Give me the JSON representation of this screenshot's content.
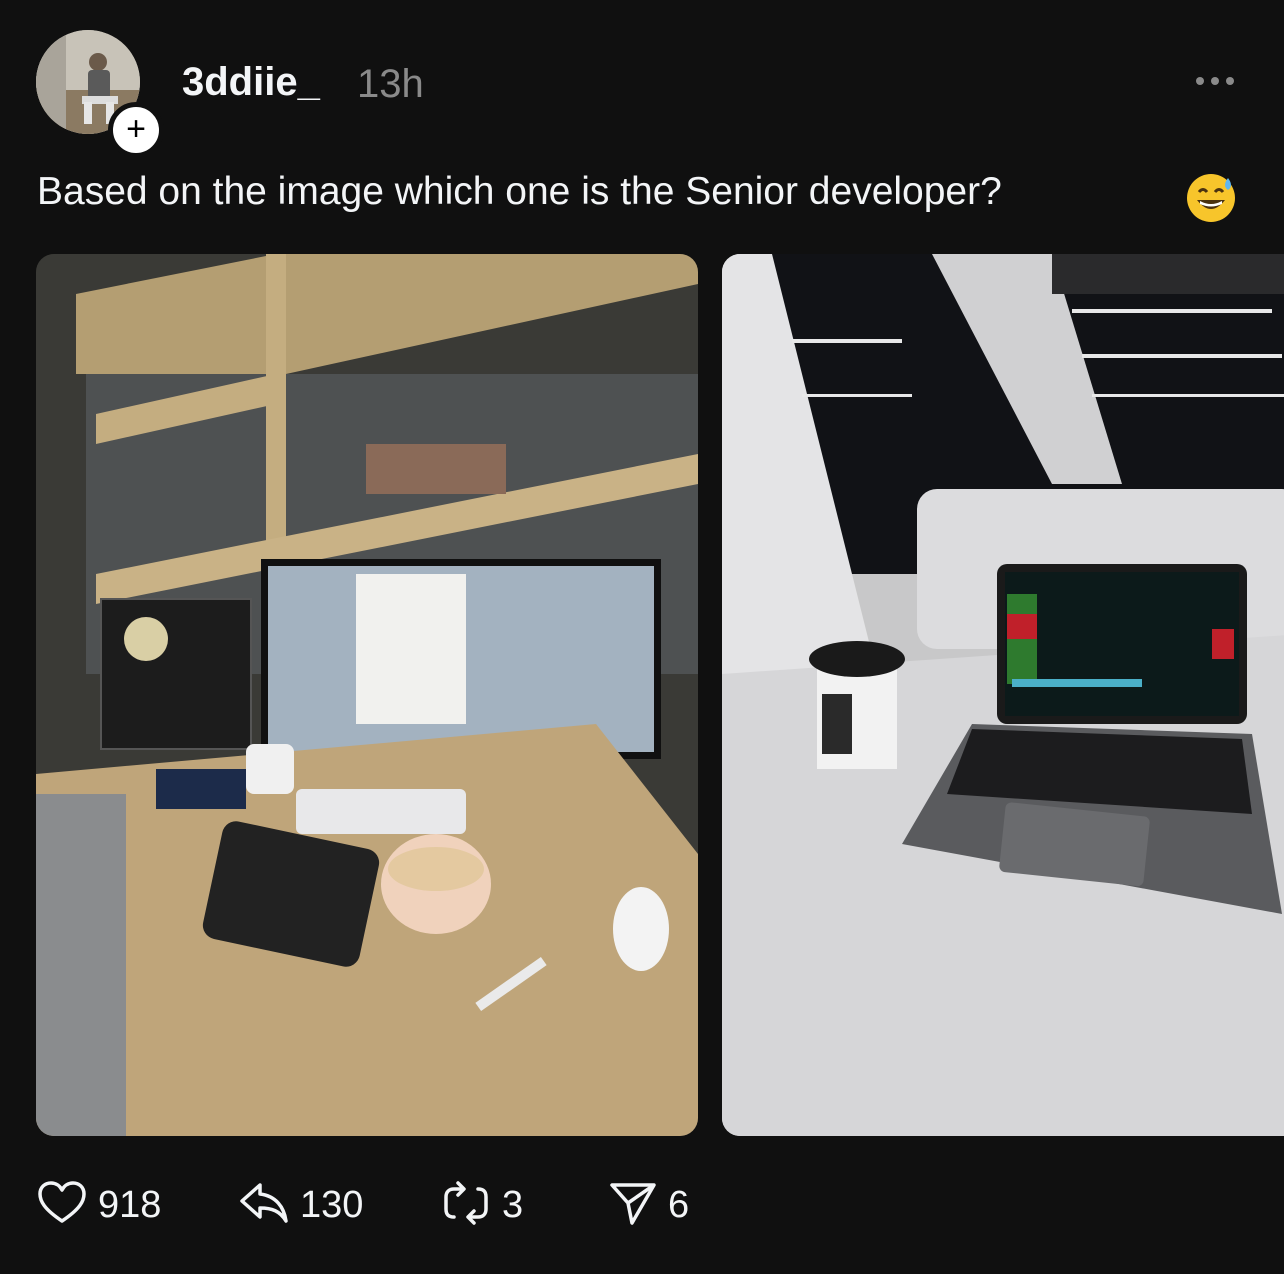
{
  "post": {
    "username": "3ddiie_",
    "time": "13h",
    "text": "Based on the image which one is the Senior developer?",
    "emoji": "grinning-face-with-sweat",
    "follow_label": "+"
  },
  "stats": {
    "likes": "918",
    "replies": "130",
    "reposts": "3",
    "shares": "6"
  },
  "images": [
    {
      "icon": "desk-setup-photo"
    },
    {
      "icon": "laptop-photo"
    }
  ],
  "colors": {
    "background": "#101010",
    "text": "#f3f5f7",
    "muted": "#8a8a8a"
  }
}
